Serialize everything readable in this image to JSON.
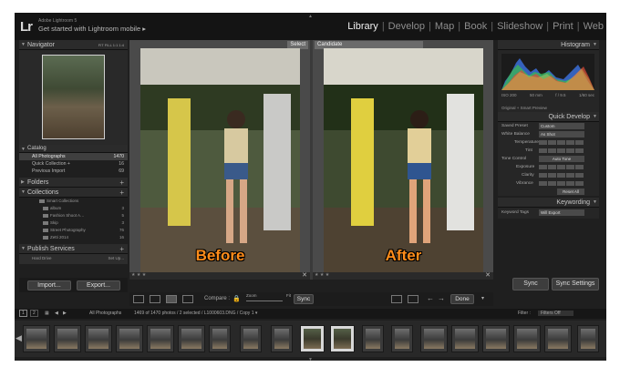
{
  "app": {
    "logo": "Lr",
    "title_small": "Adobe Lightroom 5",
    "title_big": "Get started with Lightroom mobile ▸",
    "modules": [
      "Library",
      "Develop",
      "Map",
      "Book",
      "Slideshow",
      "Print",
      "Web"
    ],
    "active_module": "Library"
  },
  "left_panel": {
    "navigator": {
      "title": "Navigator",
      "controls": "FIT  FILL  1:1  1:4"
    },
    "catalog": {
      "title": "Catalog",
      "items": [
        {
          "label": "All Photographs",
          "count": "1470"
        },
        {
          "label": "Quick Collection +",
          "count": "16"
        },
        {
          "label": "Previous Import",
          "count": "69"
        }
      ]
    },
    "folders": {
      "title": "Folders"
    },
    "collections": {
      "title": "Collections",
      "items": [
        {
          "label": "Smart Collections",
          "count": ""
        },
        {
          "label": "album",
          "count": "3"
        },
        {
          "label": "Fashion Shoot A…",
          "count": "5"
        },
        {
          "label": "Skip",
          "count": "3"
        },
        {
          "label": "Street Photography",
          "count": "76"
        },
        {
          "label": "Zetti 2014",
          "count": "16"
        }
      ]
    },
    "publish_services": {
      "title": "Publish Services",
      "item_label": "Hard Drive",
      "item_action": "Set Up..."
    },
    "import_button": "Import...",
    "export_button": "Export..."
  },
  "compare": {
    "select_tag": "Select",
    "candidate_tag": "Candidate",
    "before_caption": "Before",
    "after_caption": "After"
  },
  "toolbar": {
    "compare_label": "Compare :",
    "zoom_label": "Zoom",
    "fit_label": "Fit",
    "sync_label": "Sync",
    "done_label": "Done"
  },
  "right_panel": {
    "histogram": {
      "title": "Histogram",
      "iso": "ISO 200",
      "focal": "50 mm",
      "aperture": "f / 9.5",
      "shutter": "1/60 sec",
      "preview_label": "Original + Smart Preview"
    },
    "quick_develop": {
      "title": "Quick Develop",
      "saved_preset_label": "Saved Preset",
      "saved_preset_value": "Custom",
      "white_balance_label": "White Balance",
      "white_balance_value": "As Shot",
      "temperature_label": "Temperature",
      "tint_label": "Tint",
      "tone_control_label": "Tone Control",
      "auto_tone_label": "Auto Tone",
      "exposure_label": "Exposure",
      "clarity_label": "Clarity",
      "vibrance_label": "Vibrance",
      "reset_label": "Reset All"
    },
    "keywording": {
      "title": "Keywording",
      "keyword_tags_label": "Keyword Tags",
      "keyword_tags_value": "Will Export"
    },
    "sync_button": "Sync",
    "sync_settings_button": "Sync Settings"
  },
  "filmstrip": {
    "page1": "1",
    "page2": "2",
    "source_label": "All Photographs",
    "info": "1469 of 1470 photos / 2 selected / L1000603.DNG / Copy 1 ▾",
    "filter_label": "Filter :",
    "filter_value": "Filters Off"
  },
  "colors": {
    "accent_caption": "#ff8c1a",
    "panel_bg": "#1f1f1f",
    "active_module": "#f2f2f2"
  }
}
